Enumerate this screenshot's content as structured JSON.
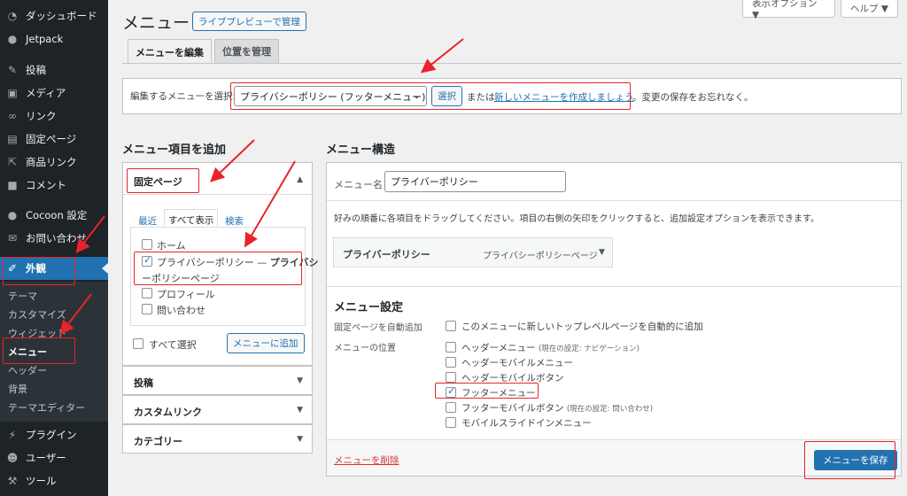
{
  "sidebar": {
    "items": [
      {
        "label": "ダッシュボード",
        "icon": "gauge-icon"
      },
      {
        "label": "Jetpack",
        "icon": "jetpack-icon"
      },
      {
        "label": "投稿",
        "icon": "pin-icon"
      },
      {
        "label": "メディア",
        "icon": "media-icon"
      },
      {
        "label": "リンク",
        "icon": "link-icon"
      },
      {
        "label": "固定ページ",
        "icon": "page-icon"
      },
      {
        "label": "商品リンク",
        "icon": "external-link-icon"
      },
      {
        "label": "コメント",
        "icon": "comment-icon"
      },
      {
        "label": "Cocoon 設定",
        "icon": "circle-icon"
      },
      {
        "label": "お問い合わせ",
        "icon": "mail-icon"
      },
      {
        "label": "外観",
        "icon": "paintbrush-icon"
      },
      {
        "label": "プラグイン",
        "icon": "plugin-icon"
      },
      {
        "label": "ユーザー",
        "icon": "user-icon"
      },
      {
        "label": "ツール",
        "icon": "wrench-icon"
      }
    ],
    "appearance_submenu": [
      "テーマ",
      "カスタマイズ",
      "ウィジェット",
      "メニュー",
      "ヘッダー",
      "背景",
      "テーマエディター"
    ],
    "current_submenu": "メニュー"
  },
  "screen_options": "表示オプション ▼",
  "help": "ヘルプ ▼",
  "page": {
    "title": "メニュー",
    "live_preview_button": "ライブプレビューで管理"
  },
  "nav_tabs": [
    "メニューを編集",
    "位置を管理"
  ],
  "select_menu": {
    "label": "編集するメニューを選択:",
    "selected": "プライバシーポリシー (フッターメニュー)",
    "select_button": "選択",
    "or_text": "または",
    "create_link": "新しいメニューを作成しましょう",
    "reminder": "。変更の保存をお忘れなく。"
  },
  "add_items": {
    "heading": "メニュー項目を追加",
    "pages_section": "固定ページ",
    "tabs": [
      "最近",
      "すべて表示",
      "検索"
    ],
    "pages": [
      {
        "label": "ホーム",
        "checked": false
      },
      {
        "label_line1": "プライバシーポリシー — ",
        "label_bold": "プライバシ",
        "label_line2": "ーポリシーページ",
        "checked": true
      },
      {
        "label": "プロフィール",
        "checked": false
      },
      {
        "label": "問い合わせ",
        "checked": false
      }
    ],
    "select_all": "すべて選択",
    "add_button": "メニューに追加",
    "other_sections": [
      "投稿",
      "カスタムリンク",
      "カテゴリー"
    ]
  },
  "structure": {
    "heading": "メニュー構造",
    "menu_name_label": "メニュー名",
    "menu_name_value": "プライバーポリシー",
    "instructions": "好みの順番に各項目をドラッグしてください。項目の右側の矢印をクリックすると、追加設定オプションを表示できます。",
    "item_title": "プライバーポリシー",
    "item_type": "プライバシーポリシーページ",
    "settings_heading": "メニュー設定",
    "auto_add_label": "固定ページを自動追加",
    "auto_add_option": "このメニューに新しいトップレベルページを自動的に追加",
    "location_label": "メニューの位置",
    "locations": [
      {
        "label": "ヘッダーメニュー",
        "note": "(現在の設定: ナビゲーション)",
        "checked": false
      },
      {
        "label": "ヘッダーモバイルメニュー",
        "note": "",
        "checked": false
      },
      {
        "label": "ヘッダーモバイルボタン",
        "note": "",
        "checked": false
      },
      {
        "label": "フッターメニュー",
        "note": "",
        "checked": true
      },
      {
        "label": "フッターモバイルボタン",
        "note": "(現在の設定: 問い合わせ)",
        "checked": false
      },
      {
        "label": "モバイルスライドインメニュー",
        "note": "",
        "checked": false
      }
    ],
    "delete_link": "メニューを削除",
    "save_button": "メニューを保存"
  },
  "colors": {
    "sidebar_bg": "#1d2327",
    "accent": "#2271b1",
    "annotation": "#e8232b",
    "delete": "#d63638"
  }
}
